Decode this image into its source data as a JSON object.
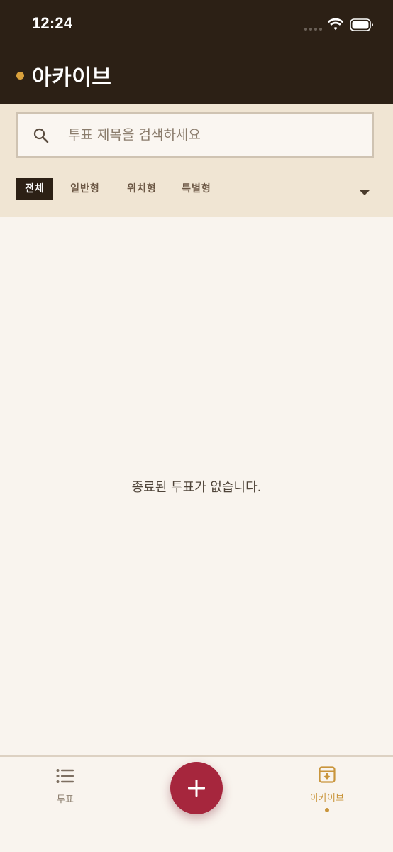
{
  "status_bar": {
    "time": "12:24"
  },
  "header": {
    "title": "아카이브",
    "dot_color": "#d9a13c"
  },
  "search": {
    "value": "",
    "placeholder": "투표 제목을 검색하세요"
  },
  "filters": {
    "chips": [
      {
        "label": "전체",
        "active": true
      },
      {
        "label": "일반형",
        "active": false
      },
      {
        "label": "위치형",
        "active": false
      },
      {
        "label": "특별형",
        "active": false
      }
    ]
  },
  "content": {
    "empty_message": "종료된 투표가 없습니다."
  },
  "bottom_nav": {
    "items": [
      {
        "label": "투표",
        "icon": "list-icon",
        "active": false
      },
      {
        "label": "아카이브",
        "icon": "archive-icon",
        "active": true
      }
    ],
    "fab_icon": "plus-icon"
  },
  "colors": {
    "header_bg": "#2c2015",
    "panel_bg": "#f0e5d3",
    "page_bg": "#f9f4ee",
    "accent": "#c9953c",
    "fab": "#a6263d"
  }
}
